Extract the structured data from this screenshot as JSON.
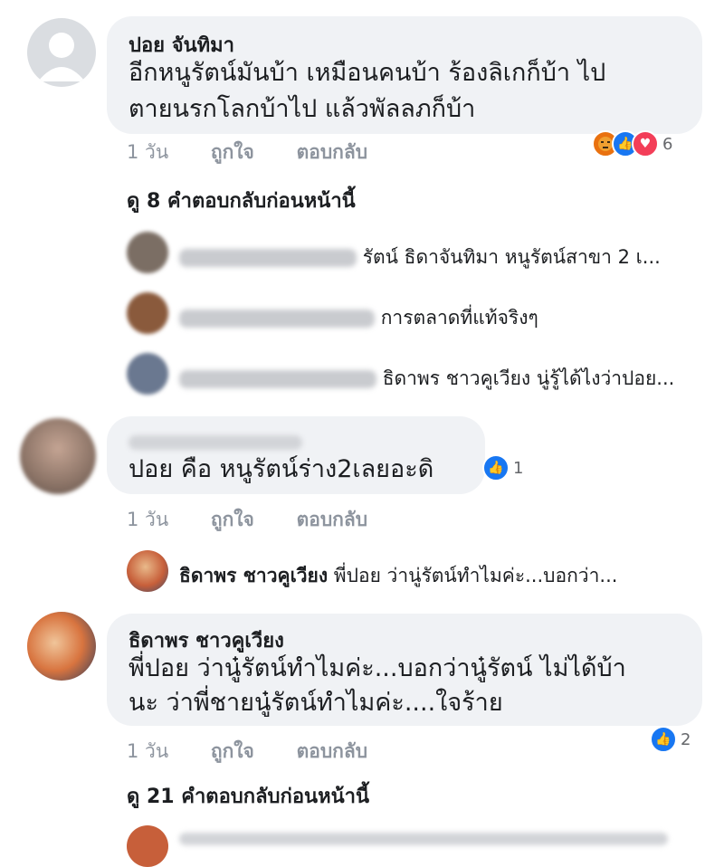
{
  "comments": [
    {
      "author": "ปอย จันทิมา",
      "text_line1": "อีกหนูรัตน์มันบ้า เหมือนคนบ้า ร้องลิเกก็บ้า ไป",
      "text_line2": "ตายนรกโลกบ้าไป แล้วพัลลภก็บ้า",
      "time": "1 วัน",
      "like": "ถูกใจ",
      "reply": "ตอบกลับ",
      "reaction_count": "6"
    },
    {
      "author": "",
      "text_line1": "ปอย คือ หนูรัตน์ร่าง2เลยอะดิ",
      "time": "1 วัน",
      "like": "ถูกใจ",
      "reply": "ตอบกลับ",
      "reaction_count": "1"
    },
    {
      "author": "ธิดาพร ชาวคูเวียง",
      "text_line1": "พี่ปอย ว่านู๋รัตน์ทำไมค่ะ...บอกว่านู๋รัตน์ ไม่ได้บ้า",
      "text_line2": "นะ ว่าพี่ชายนู๋รัตน์ทำไมค่ะ....ใจร้าย",
      "time": "1 วัน",
      "like": "ถูกใจ",
      "reply": "ตอบกลับ",
      "reaction_count": "2"
    }
  ],
  "view_more_1": "ดู 8 คำตอบกลับก่อนหน้านี้",
  "view_more_2": "ดู 21 คำตอบกลับก่อนหน้านี้",
  "replies_1": [
    {
      "text": "รัตน์ ธิดาจันทิมา หนูรัตน์สาขา 2 เ..."
    },
    {
      "text": "การตลาดที่แท้จริงๆ"
    },
    {
      "text": "ธิดาพร ชาวคูเวียง นู่รู้ได้ไงว่าปอย..."
    }
  ],
  "reply_2": {
    "author": "ธิดาพร ชาวคูเวียง",
    "text": "พี่ปอย ว่านู่รัตน์ทำไมค่ะ...บอกว่า..."
  },
  "colors": {
    "bubble": "#f0f2f5",
    "like_blue": "#1877f2",
    "love_red": "#f33e58",
    "angry_orange": "#e9710f",
    "meta_gray": "#8d949e"
  },
  "icons": {
    "angry": "angry-face-icon",
    "like": "thumbs-up-icon",
    "love": "heart-icon"
  }
}
